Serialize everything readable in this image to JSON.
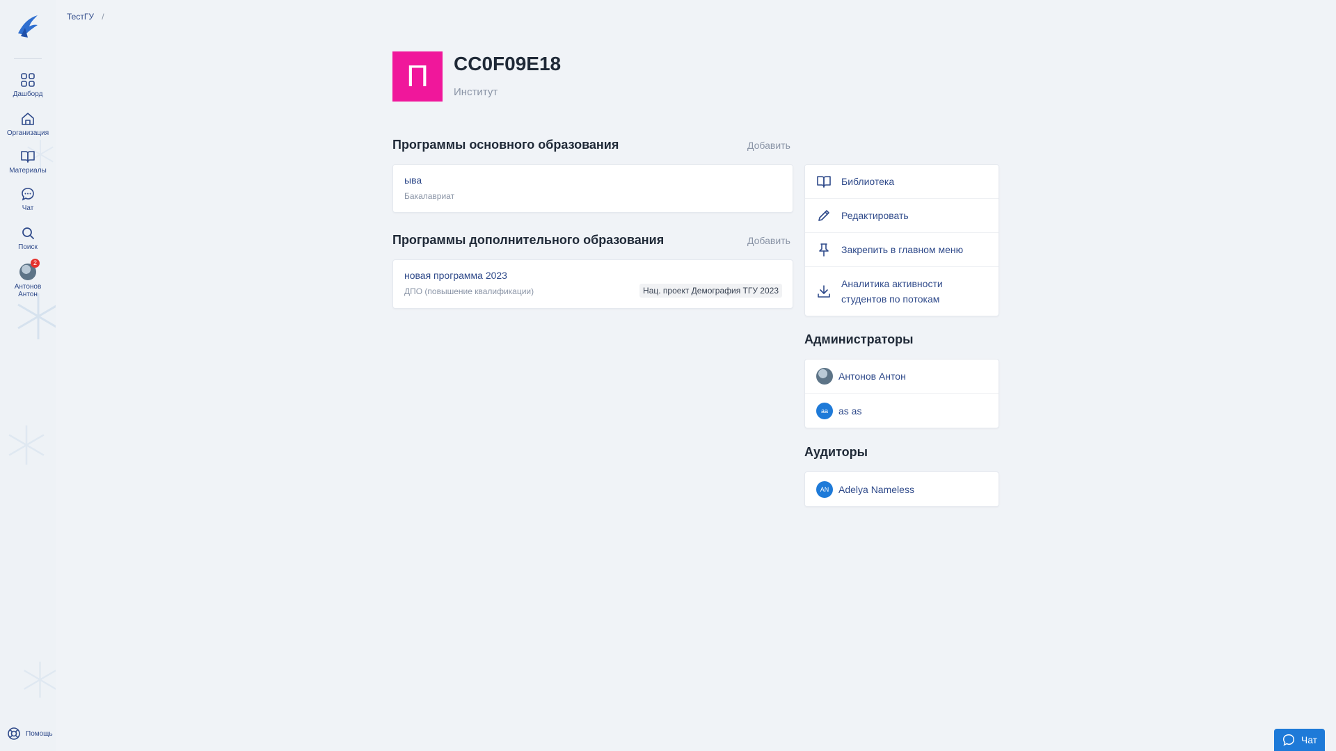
{
  "sidebar": {
    "items": [
      {
        "label": "Дашборд",
        "icon": "dashboard-icon"
      },
      {
        "label": "Организация",
        "icon": "home-icon"
      },
      {
        "label": "Материалы",
        "icon": "book-icon"
      },
      {
        "label": "Чат",
        "icon": "chat-icon"
      },
      {
        "label": "Поиск",
        "icon": "search-icon"
      },
      {
        "label": "Антонов Антон",
        "icon": "avatar",
        "badge": "2"
      }
    ],
    "help_label": "Помощь"
  },
  "breadcrumb": {
    "root": "ТестГУ",
    "separator": "/"
  },
  "header": {
    "avatar_letter": "П",
    "avatar_color": "#f0179b",
    "title": "CC0F09E18",
    "subtitle": "Институт"
  },
  "main_programs": {
    "title": "Программы основного образования",
    "add_label": "Добавить",
    "items": [
      {
        "name": "ыва",
        "type": "Бакалавриат"
      }
    ]
  },
  "extra_programs": {
    "title": "Программы дополнительного образования",
    "add_label": "Добавить",
    "items": [
      {
        "name": "новая программа 2023",
        "type": "ДПО (повышение квалификации)",
        "tag": "Нац. проект Демография ТГУ 2023"
      }
    ]
  },
  "actions": {
    "library": "Библиотека",
    "edit": "Редактировать",
    "pin": "Закрепить в главном меню",
    "analytics": "Аналитика активности студентов по потокам"
  },
  "admins": {
    "title": "Администраторы",
    "people": [
      {
        "name": "Антонов Антон",
        "initials": ""
      },
      {
        "name": "as as",
        "initials": "aa"
      }
    ]
  },
  "auditors": {
    "title": "Аудиторы",
    "people": [
      {
        "name": "Adelya Nameless",
        "initials": "AN"
      }
    ]
  },
  "chat_widget": {
    "label": "Чат"
  },
  "colors": {
    "accent": "#1e7ad8",
    "link": "#2f4a8a",
    "org_avatar": "#f0179b"
  }
}
